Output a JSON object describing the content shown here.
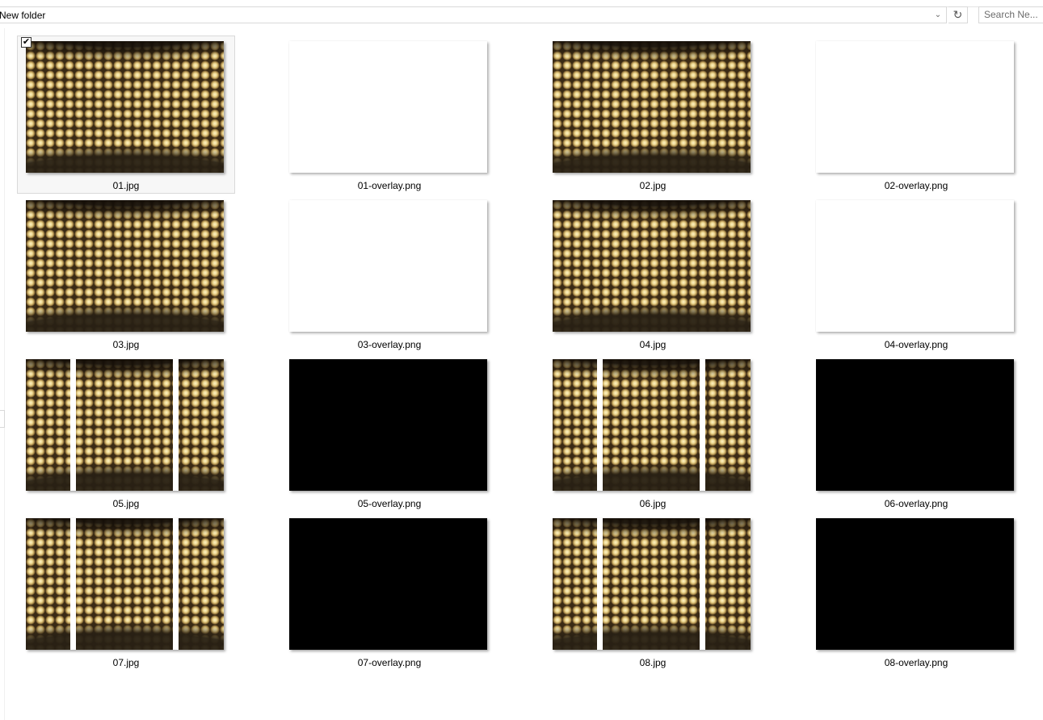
{
  "address_bar": {
    "path": "New folder",
    "dropdown_icon": "chevron-down-icon",
    "refresh_icon": "refresh-icon"
  },
  "search": {
    "placeholder": "Search Ne..."
  },
  "files": [
    {
      "name": "01.jpg",
      "kind": "lights",
      "selected": true
    },
    {
      "name": "01-overlay.png",
      "kind": "white",
      "selected": false
    },
    {
      "name": "02.jpg",
      "kind": "lights",
      "selected": false
    },
    {
      "name": "02-overlay.png",
      "kind": "white",
      "selected": false
    },
    {
      "name": "03.jpg",
      "kind": "lights",
      "selected": false
    },
    {
      "name": "03-overlay.png",
      "kind": "white",
      "selected": false
    },
    {
      "name": "04.jpg",
      "kind": "lights",
      "selected": false
    },
    {
      "name": "04-overlay.png",
      "kind": "white",
      "selected": false
    },
    {
      "name": "05.jpg",
      "kind": "lights-split",
      "selected": false
    },
    {
      "name": "05-overlay.png",
      "kind": "black",
      "selected": false
    },
    {
      "name": "06.jpg",
      "kind": "lights-split",
      "selected": false
    },
    {
      "name": "06-overlay.png",
      "kind": "black",
      "selected": false
    },
    {
      "name": "07.jpg",
      "kind": "lights-split",
      "selected": false
    },
    {
      "name": "07-overlay.png",
      "kind": "black",
      "selected": false
    },
    {
      "name": "08.jpg",
      "kind": "lights-split",
      "selected": false
    },
    {
      "name": "08-overlay.png",
      "kind": "black",
      "selected": false
    }
  ]
}
